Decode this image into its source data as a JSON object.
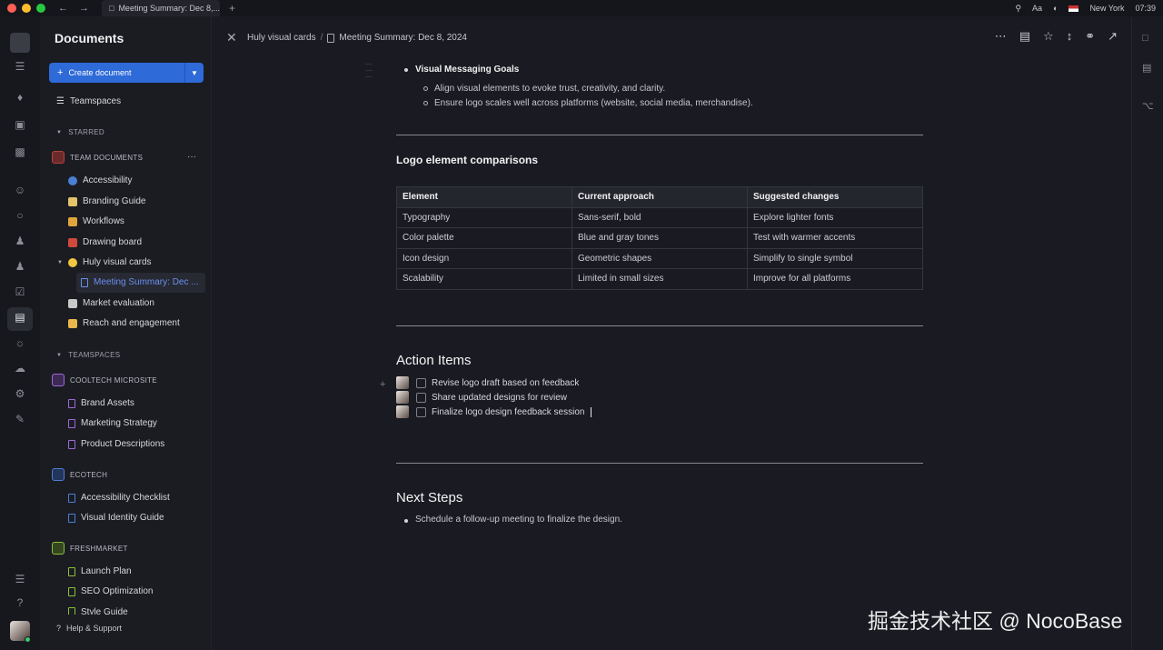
{
  "window": {
    "tab_title": "Meeting Summary: Dec 8,...",
    "status": {
      "font_label": "Aa",
      "location": "New York",
      "time": "07:39"
    }
  },
  "sidebar": {
    "title": "Documents",
    "create_label": "Create document",
    "teamspaces_link": "Teamspaces",
    "starred_label": "STARRED",
    "team_documents": {
      "label": "TEAM DOCUMENTS",
      "more": "···",
      "items": [
        {
          "label": "Accessibility",
          "color": "#4a7fd4"
        },
        {
          "label": "Branding Guide",
          "color": "#e4c36b"
        },
        {
          "label": "Workflows",
          "color": "#e0a63c"
        },
        {
          "label": "Drawing board",
          "color": "#d0493f"
        },
        {
          "label": "Huly visual cards",
          "color": "#f2c740"
        },
        {
          "label": "Meeting Summary: Dec ...",
          "color": "#6b8ef0"
        },
        {
          "label": "Market evaluation",
          "color": "#c9c9c9"
        },
        {
          "label": "Reach and engagement",
          "color": "#e9b84a"
        }
      ]
    },
    "teamspaces_label": "TEAMSPACES",
    "groups": [
      {
        "label": "COOLTECH MICROSITE",
        "color": "#9b6ad8",
        "items": [
          "Brand Assets",
          "Marketing Strategy",
          "Product Descriptions"
        ]
      },
      {
        "label": "ECOTECH",
        "color": "#4a7fd4",
        "items": [
          "Accessibility Checklist",
          "Visual Identity Guide"
        ]
      },
      {
        "label": "FRESHMARKET",
        "color": "#8bbf3b",
        "items": [
          "Launch Plan",
          "SEO Optimization",
          "Style Guide"
        ]
      }
    ],
    "help": "Help & Support"
  },
  "header": {
    "crumb_parent": "Huly visual cards",
    "crumb_sep": "/",
    "crumb_current": "Meeting Summary: Dec 8, 2024"
  },
  "doc": {
    "goals_title": "Visual Messaging Goals",
    "goals_items": [
      "Align visual elements to evoke trust, creativity, and clarity.",
      "Ensure logo scales well across platforms (website, social media, merchandise)."
    ],
    "comparison_title": "Logo element comparisons",
    "table": {
      "headers": [
        "Element",
        "Current approach",
        "Suggested changes"
      ],
      "rows": [
        [
          "Typography",
          "Sans-serif, bold",
          "Explore lighter fonts"
        ],
        [
          "Color palette",
          "Blue and gray tones",
          "Test with warmer accents"
        ],
        [
          "Icon design",
          "Geometric shapes",
          "Simplify to single symbol"
        ],
        [
          "Scalability",
          "Limited in small sizes",
          "Improve for all platforms"
        ]
      ]
    },
    "action_title": "Action Items",
    "tasks": [
      "Revise logo draft based on feedback",
      "Share updated designs for review",
      "Finalize logo design feedback session"
    ],
    "next_title": "Next Steps",
    "next_items": [
      "Schedule a follow-up meeting to finalize the design."
    ]
  },
  "watermark": "掘金技术社区 @ NocoBase"
}
